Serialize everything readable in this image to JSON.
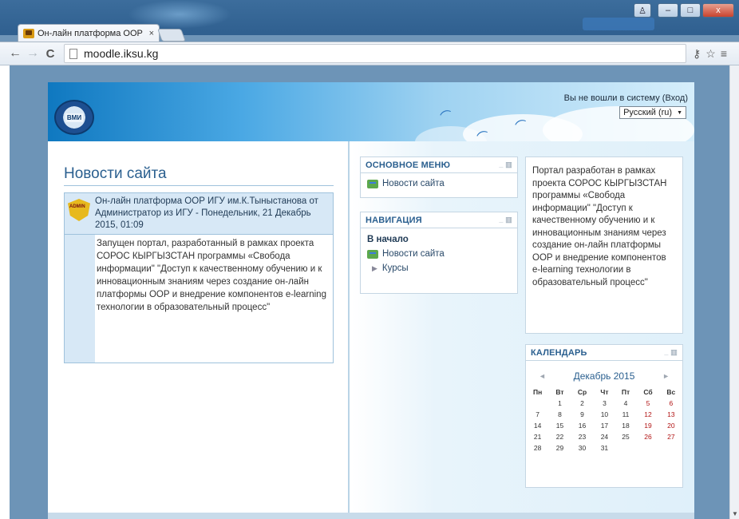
{
  "browser": {
    "tab_title": "Он-лайн платформа ООР",
    "tab_close": "×",
    "address": "moodle.iksu.kg",
    "back": "←",
    "forward": "→",
    "reload": "C",
    "key_icon": "⚷",
    "star_icon": "☆",
    "menu_icon": "≡",
    "win_user": "♙",
    "win_min": "–",
    "win_max": "□",
    "win_close": "x"
  },
  "header": {
    "login_text": "Вы не вошли в систему (",
    "login_link": "Вход",
    "login_close": ")",
    "language": "Русский (ru)",
    "language_arrow": "▼",
    "logo_text": "ВМИ"
  },
  "news": {
    "title": "Новости сайта",
    "post": {
      "avatar_text": "ADMIN",
      "header_text": "Он-лайн платформа ООР ИГУ им.К.Тыныстанова от Администратор из ИГУ - Понедельник, 21 Декабрь 2015, 01:09",
      "body": "Запущен портал, разработанный в рамках проекта СОРОС КЫРГЫЗСТАН программы «Свобода информации\" \"Доступ к качественному обучению и к инновационным знаниям через создание он-лайн платформы ООР и внедрение компонентов e-learning технологии в образовательный процесс\""
    }
  },
  "main_menu": {
    "title": "ОСНОВНОЕ МЕНЮ",
    "items": [
      "Новости сайта"
    ]
  },
  "navigation": {
    "title": "НАВИГАЦИЯ",
    "home": "В начало",
    "news": "Новости сайта",
    "courses": "Курсы"
  },
  "info_block": {
    "text": "Портал разработан в рамках проекта СОРОС КЫРГЫЗСТАН программы «Свобода информации\" \"Доступ к качественному обучению и к инновационным знаниям через создание он-лайн платформы ООР и внедрение компонентов e-learning технологии в образовательный процесс\""
  },
  "calendar": {
    "title": "КАЛЕНДАРЬ",
    "month": "Декабрь 2015",
    "prev": "◄",
    "next": "►",
    "weekdays": [
      "Пн",
      "Вт",
      "Ср",
      "Чт",
      "Пт",
      "Сб",
      "Вс"
    ],
    "weeks": [
      [
        "",
        "1",
        "2",
        "3",
        "4",
        "5",
        "6"
      ],
      [
        "7",
        "8",
        "9",
        "10",
        "11",
        "12",
        "13"
      ],
      [
        "14",
        "15",
        "16",
        "17",
        "18",
        "19",
        "20"
      ],
      [
        "21",
        "22",
        "23",
        "24",
        "25",
        "26",
        "27"
      ],
      [
        "28",
        "29",
        "30",
        "31",
        "",
        "",
        ""
      ]
    ]
  },
  "block_ctl": "_ ▥"
}
